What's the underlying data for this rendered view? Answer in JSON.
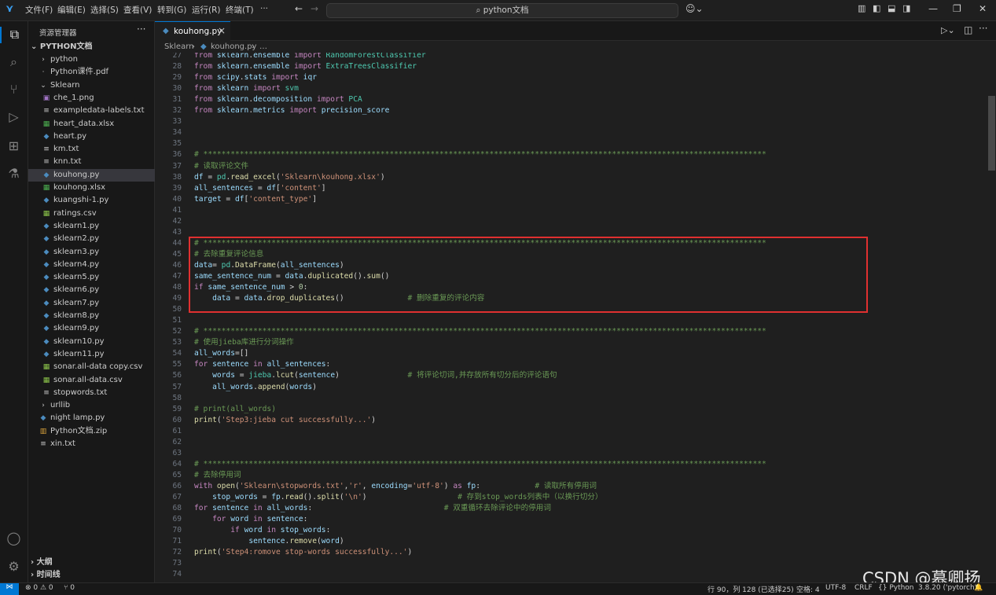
{
  "menu": [
    "文件(F)",
    "编辑(E)",
    "选择(S)",
    "查看(V)",
    "转到(G)",
    "运行(R)",
    "终端(T)",
    "···"
  ],
  "search": {
    "text": "python文档"
  },
  "sidebar": {
    "title": "资源管理器",
    "root": "PYTHON文档",
    "items": [
      {
        "label": "python",
        "type": "folder"
      },
      {
        "label": "Python课件.pdf",
        "type": "file"
      },
      {
        "label": "Sklearn",
        "type": "folder-open"
      },
      {
        "label": "che_1.png",
        "type": "image"
      },
      {
        "label": "exampledata-labels.txt",
        "type": "txt"
      },
      {
        "label": "heart_data.xlsx",
        "type": "xlsx"
      },
      {
        "label": "heart.py",
        "type": "py"
      },
      {
        "label": "km.txt",
        "type": "txt"
      },
      {
        "label": "knn.txt",
        "type": "txt"
      },
      {
        "label": "kouhong.py",
        "type": "py"
      },
      {
        "label": "kouhong.xlsx",
        "type": "xlsx"
      },
      {
        "label": "kuangshi-1.py",
        "type": "py"
      },
      {
        "label": "ratings.csv",
        "type": "csv"
      },
      {
        "label": "sklearn1.py",
        "type": "py"
      },
      {
        "label": "sklearn2.py",
        "type": "py"
      },
      {
        "label": "sklearn3.py",
        "type": "py"
      },
      {
        "label": "sklearn4.py",
        "type": "py"
      },
      {
        "label": "sklearn5.py",
        "type": "py"
      },
      {
        "label": "sklearn6.py",
        "type": "py"
      },
      {
        "label": "sklearn7.py",
        "type": "py"
      },
      {
        "label": "sklearn8.py",
        "type": "py"
      },
      {
        "label": "sklearn9.py",
        "type": "py"
      },
      {
        "label": "sklearn10.py",
        "type": "py"
      },
      {
        "label": "sklearn11.py",
        "type": "py"
      },
      {
        "label": "sonar.all-data copy.csv",
        "type": "csv"
      },
      {
        "label": "sonar.all-data.csv",
        "type": "csv"
      },
      {
        "label": "stopwords.txt",
        "type": "txt"
      },
      {
        "label": "urllib",
        "type": "folder"
      },
      {
        "label": "night lamp.py",
        "type": "py"
      },
      {
        "label": "Python文档.zip",
        "type": "zip"
      },
      {
        "label": "xin.txt",
        "type": "txt"
      }
    ],
    "outline": "大纲",
    "timeline": "时间线"
  },
  "tab": {
    "label": "kouhong.py",
    "close": "×"
  },
  "breadcrumb": {
    "folder": "Sklearn",
    "sep": "›",
    "file": "kouhong.py",
    "more": "…"
  },
  "code": [
    {
      "n": "27",
      "t": "from sklearn.ensemble import RandomForestClassifier"
    },
    {
      "n": "28",
      "t": "from sklearn.ensemble import ExtraTreesClassifier"
    },
    {
      "n": "29",
      "t": "from scipy.stats import iqr"
    },
    {
      "n": "30",
      "t": "from sklearn import svm"
    },
    {
      "n": "31",
      "t": "from sklearn.decomposition import PCA"
    },
    {
      "n": "32",
      "t": "from sklearn.metrics import precision_score"
    },
    {
      "n": "33",
      "t": ""
    },
    {
      "n": "34",
      "t": ""
    },
    {
      "n": "35",
      "t": ""
    },
    {
      "n": "36",
      "t": "# ****************************************************************************************************************************"
    },
    {
      "n": "37",
      "t": "# 读取评论文件"
    },
    {
      "n": "38",
      "t": "df = pd.read_excel('Sklearn\\kouhong.xlsx')"
    },
    {
      "n": "39",
      "t": "all_sentences = df['content']"
    },
    {
      "n": "40",
      "t": "target = df['content_type']"
    },
    {
      "n": "41",
      "t": ""
    },
    {
      "n": "42",
      "t": ""
    },
    {
      "n": "43",
      "t": ""
    },
    {
      "n": "44",
      "t": "# ****************************************************************************************************************************"
    },
    {
      "n": "45",
      "t": "# 去除重复评论信息"
    },
    {
      "n": "46",
      "t": "data= pd.DataFrame(all_sentences)"
    },
    {
      "n": "47",
      "t": "same_sentence_num = data.duplicated().sum()"
    },
    {
      "n": "48",
      "t": "if same_sentence_num > 0:"
    },
    {
      "n": "49",
      "t": "    data = data.drop_duplicates()              # 删除重复的评论内容"
    },
    {
      "n": "50",
      "t": ""
    },
    {
      "n": "51",
      "t": ""
    },
    {
      "n": "52",
      "t": "# ****************************************************************************************************************************"
    },
    {
      "n": "53",
      "t": "# 使用jieba库进行分词操作"
    },
    {
      "n": "54",
      "t": "all_words=[]"
    },
    {
      "n": "55",
      "t": "for sentence in all_sentences:"
    },
    {
      "n": "56",
      "t": "    words = jieba.lcut(sentence)               # 将评论切词,并存放所有切分后的评论语句"
    },
    {
      "n": "57",
      "t": "    all_words.append(words)"
    },
    {
      "n": "58",
      "t": ""
    },
    {
      "n": "59",
      "t": "# print(all_words)"
    },
    {
      "n": "60",
      "t": "print('Step3:jieba cut successfully...')"
    },
    {
      "n": "61",
      "t": ""
    },
    {
      "n": "62",
      "t": ""
    },
    {
      "n": "63",
      "t": ""
    },
    {
      "n": "64",
      "t": "# ****************************************************************************************************************************"
    },
    {
      "n": "65",
      "t": "# 去除停用词"
    },
    {
      "n": "66",
      "t": "with open('Sklearn\\stopwords.txt','r', encoding='utf-8') as fp:            # 读取所有停用词"
    },
    {
      "n": "67",
      "t": "    stop_words = fp.read().split('\\n')                    # 存到stop_words列表中（以换行切分）"
    },
    {
      "n": "68",
      "t": "for sentence in all_words:                             # 双重循环去除评论中的停用词"
    },
    {
      "n": "69",
      "t": "    for word in sentence:"
    },
    {
      "n": "70",
      "t": "        if word in stop_words:"
    },
    {
      "n": "71",
      "t": "            sentence.remove(word)"
    },
    {
      "n": "72",
      "t": "print('Step4:romove stop-words successfully...')"
    },
    {
      "n": "73",
      "t": ""
    },
    {
      "n": "74",
      "t": ""
    }
  ],
  "status": {
    "errors": "⊗ 0 ⚠ 0",
    "ports": "⑂ 0",
    "position": "行 90，列 128 (已选择25)",
    "spaces": "空格: 4",
    "encoding": "UTF-8",
    "eol": "CRLF",
    "language": "{} Python",
    "interpreter": "3.8.20 ('pytorch')"
  },
  "watermark": "CSDN @慕卿扬",
  "colors": {
    "accent": "#0078d4",
    "highlight": "#e03030"
  }
}
